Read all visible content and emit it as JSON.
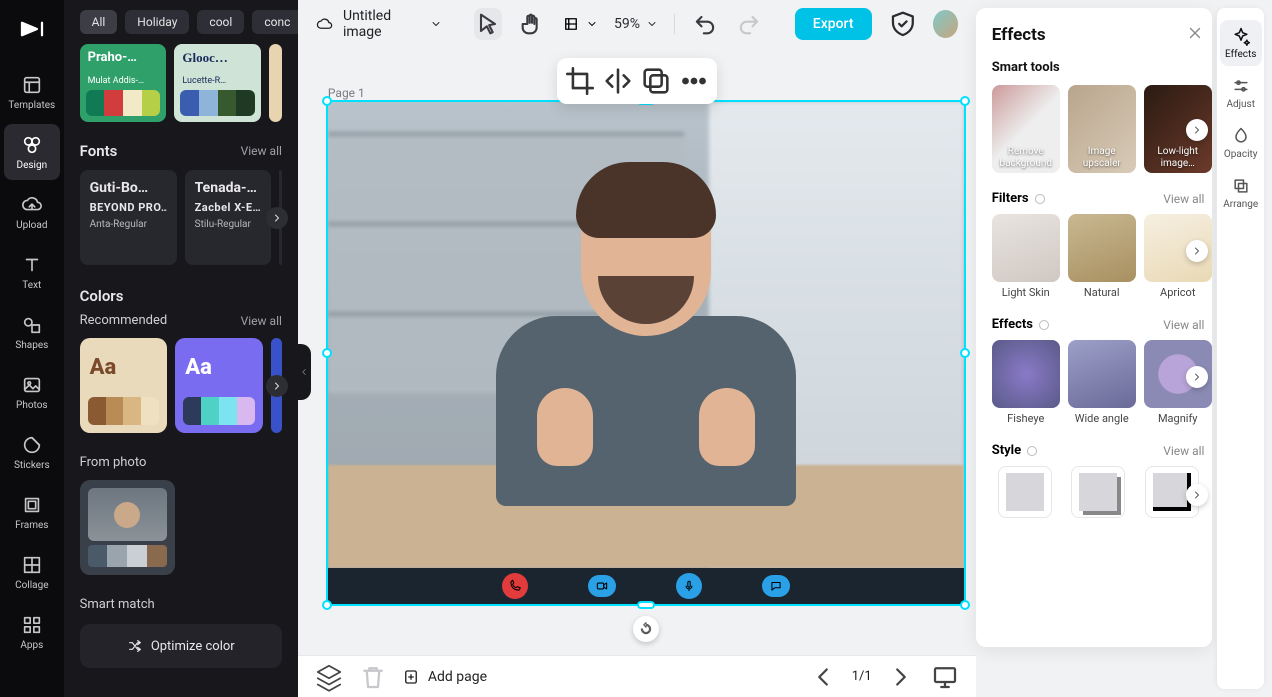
{
  "topbar": {
    "title": "Untitled image",
    "zoom": "59%",
    "export": "Export"
  },
  "nav": {
    "templates": "Templates",
    "design": "Design",
    "upload": "Upload",
    "text": "Text",
    "shapes": "Shapes",
    "photos": "Photos",
    "stickers": "Stickers",
    "frames": "Frames",
    "collage": "Collage",
    "apps": "Apps"
  },
  "panel": {
    "tags": {
      "all": "All",
      "holiday": "Holiday",
      "cool": "cool",
      "conc": "conc"
    },
    "sw1": {
      "title": "Praho-…",
      "sub": "Mulat Addis-…"
    },
    "sw2": {
      "title": "Glooc…",
      "sub": "Lucette-R…"
    },
    "fonts": {
      "heading": "Fonts",
      "viewall": "View all",
      "c1l1": "Guti-Bo…",
      "c1l2": "BEYOND PRO…",
      "c1l3": "Anta-Regular",
      "c2l1": "Tenada-…",
      "c2l2": "Zacbel X-E…",
      "c2l3": "Stilu-Regular"
    },
    "colors": {
      "heading": "Colors",
      "recommended": "Recommended",
      "viewall": "View all",
      "fromphoto": "From photo",
      "smartmatch": "Smart match",
      "optimize": "Optimize color",
      "aa": "Aa"
    }
  },
  "canvas": {
    "pageLabel": "Page 1"
  },
  "rail": {
    "effects": "Effects",
    "adjust": "Adjust",
    "opacity": "Opacity",
    "arrange": "Arrange"
  },
  "fx": {
    "title": "Effects",
    "smart": "Smart tools",
    "smart1": "Remove background",
    "smart2": "Image upscaler",
    "smart3": "Low-light image…",
    "filters": "Filters",
    "viewall": "View all",
    "f1": "Light Skin",
    "f2": "Natural",
    "f3": "Apricot",
    "effects": "Effects",
    "e1": "Fisheye",
    "e2": "Wide angle",
    "e3": "Magnify",
    "style": "Style"
  },
  "bottom": {
    "addpage": "Add page",
    "pages": "1/1"
  }
}
